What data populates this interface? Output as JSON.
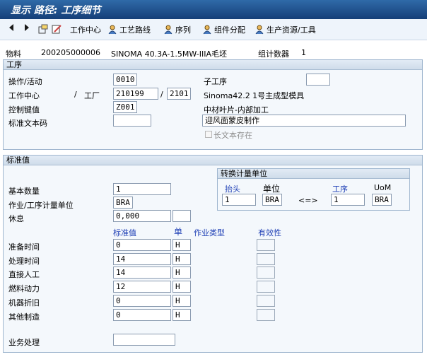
{
  "title": "显示 路径: 工序细节",
  "toolbar": {
    "work_center": "工作中心",
    "routing": "工艺路线",
    "sequence": "序列",
    "component_alloc": "组件分配",
    "prt": "生产资源/工具"
  },
  "header": {
    "material_label": "物料",
    "material_value": "200205000006",
    "material_desc": "SINOMA 40.3A-1.5MW-IIIA毛坯",
    "group_counter_label": "组计数器",
    "group_counter_value": "1"
  },
  "operation": {
    "section_title": "工序",
    "activity_label": "操作/活动",
    "activity_value": "0010",
    "sub_operation_label": "子工序",
    "sub_operation_value": "",
    "work_center_label": "工作中心",
    "slash1": "/",
    "plant_label": "工厂",
    "work_center_value": "210199",
    "slash2": "/",
    "plant_value": "2101",
    "work_center_desc": "Sinoma42.2 1号主成型模具",
    "control_key_label": "控制键值",
    "control_key_value": "Z001",
    "control_key_desc": "中材叶片-内部加工",
    "std_text_label": "标准文本码",
    "std_text_value": "",
    "op_text": "迎风面蒙皮制作",
    "long_text_label": "长文本存在"
  },
  "standard_values": {
    "section_title": "标准值",
    "base_qty_label": "基本数量",
    "base_qty_value": "1",
    "uom_label": "作业/工序计量单位",
    "uom_value": "BRA",
    "break_label": "休息",
    "break_value": "0,000",
    "break_unit": "",
    "conv_box_title": "转换计量单位",
    "conv_header_label": "抬头",
    "conv_unit_label": "单位",
    "conv_op_label": "工序",
    "conv_uom_label": "UoM",
    "conv_header_value": "1",
    "conv_header_unit": "BRA",
    "conv_arrow": "<=>",
    "conv_op_value": "1",
    "conv_op_unit": "BRA",
    "col_std_value": "标准值",
    "col_unit": "单",
    "col_activity_type": "作业类型",
    "col_validity": "有效性",
    "rows": [
      {
        "label": "准备时间",
        "value": "0",
        "unit": "H",
        "activity": "",
        "validity": ""
      },
      {
        "label": "处理时间",
        "value": "14",
        "unit": "H",
        "activity": "",
        "validity": ""
      },
      {
        "label": "直接人工",
        "value": "14",
        "unit": "H",
        "activity": "",
        "validity": ""
      },
      {
        "label": "燃料动力",
        "value": "12",
        "unit": "H",
        "activity": "",
        "validity": ""
      },
      {
        "label": "机器折旧",
        "value": "0",
        "unit": "H",
        "activity": "",
        "validity": ""
      },
      {
        "label": "其他制造",
        "value": "0",
        "unit": "H",
        "activity": "",
        "validity": ""
      }
    ],
    "business_proc_label": "业务处理",
    "business_proc_value": ""
  }
}
